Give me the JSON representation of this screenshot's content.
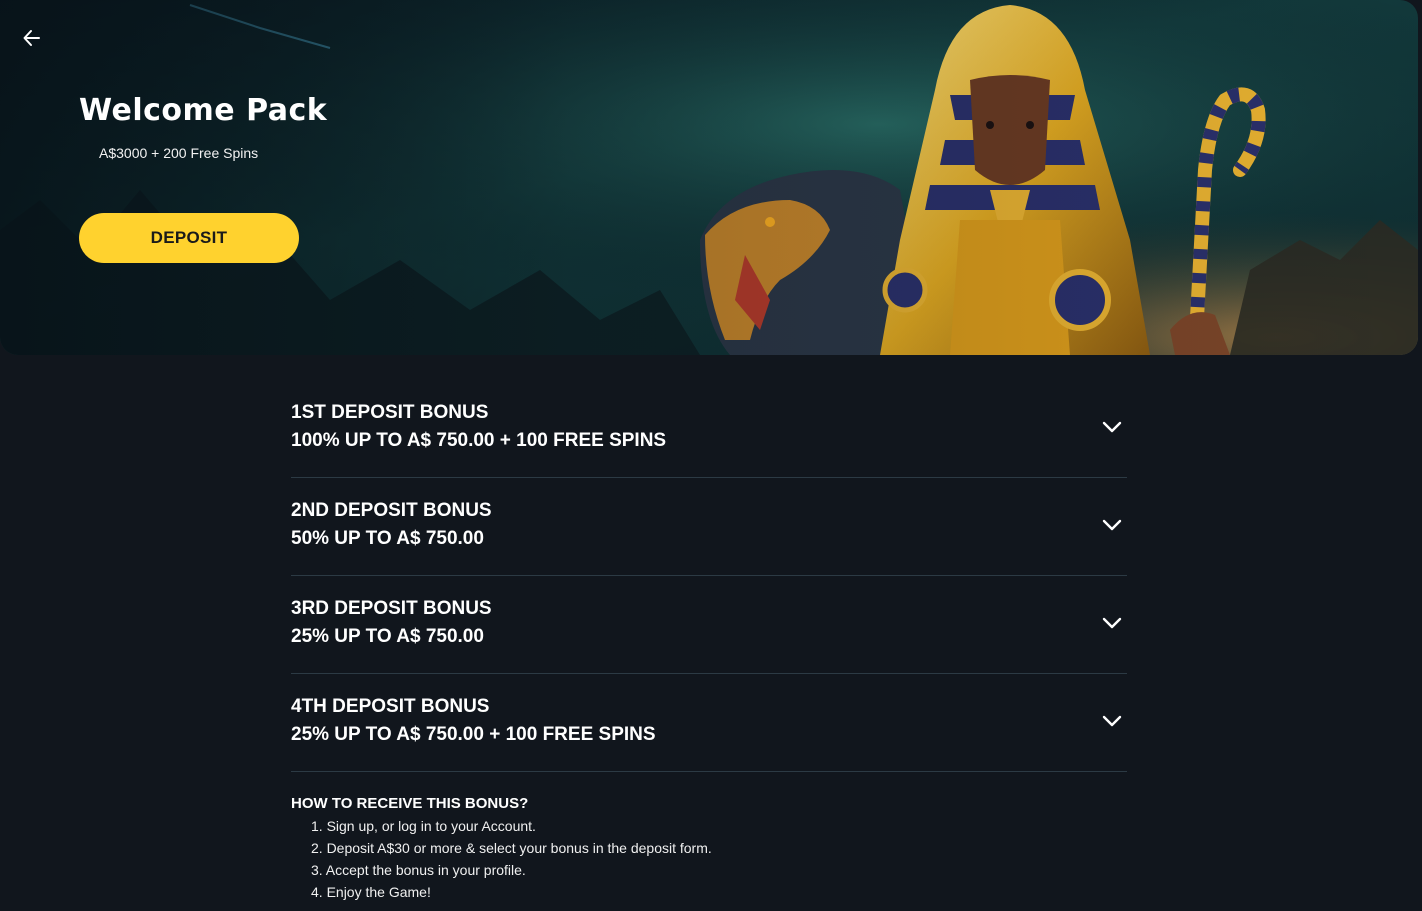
{
  "hero": {
    "title": "Welcome Pack",
    "subtitle": "A$3000 + 200 Free Spins",
    "deposit_label": "DEPOSIT"
  },
  "bonuses": [
    {
      "title": "1ST DEPOSIT BONUS",
      "detail": "100% UP TO A$ 750.00 + 100 FREE SPINS"
    },
    {
      "title": "2ND DEPOSIT BONUS",
      "detail": "50% UP TO A$ 750.00"
    },
    {
      "title": "3RD DEPOSIT BONUS",
      "detail": "25% UP TO A$ 750.00"
    },
    {
      "title": "4TH DEPOSIT BONUS",
      "detail": "25% UP TO A$ 750.00 + 100 FREE SPINS"
    }
  ],
  "howto": {
    "title": "HOW TO RECEIVE THIS BONUS?",
    "steps": [
      "1. Sign up, or log in to your Account.",
      "2. Deposit A$30 or more & select your bonus in the deposit form.",
      "3. Accept the bonus in your profile.",
      "4. Enjoy the Game!"
    ]
  },
  "icons": {
    "back": "arrow-left-icon",
    "expand": "chevron-down-icon"
  },
  "colors": {
    "background": "#11161d",
    "accent": "#ffd22e",
    "divider": "#2c3a44"
  }
}
